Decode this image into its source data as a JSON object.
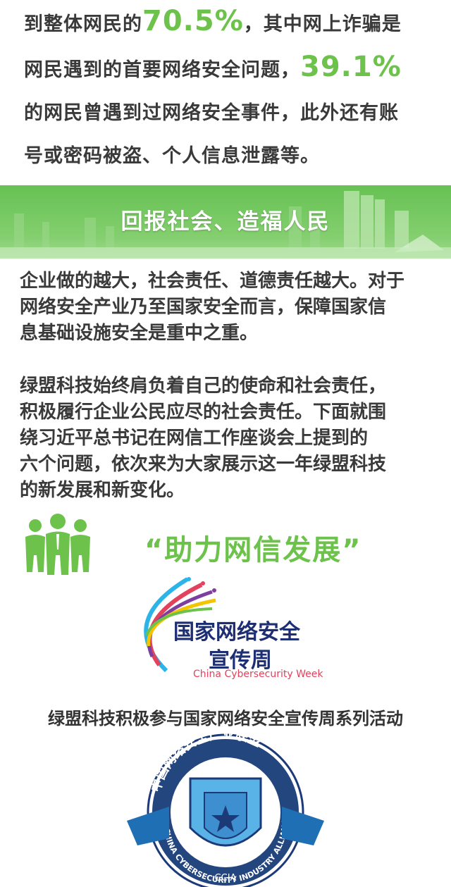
{
  "intro": {
    "line1_a": "到整体网民的",
    "line1_pct": "70.5%",
    "line1_b": "，其中网上诈骗是",
    "line2_a": "网民遇到的首要网络安全问题，",
    "line2_pct": "39.1%",
    "line3": "的网民曾遇到过网络安全事件，此外还有账",
    "line4": "号或密码被盗、个人信息泄露等。"
  },
  "banner": {
    "title": "回报社会、造福人民"
  },
  "para1": [
    "企业做的越大，社会责任、道德责任越大。对于",
    "网络安全产业乃至国家安全而言，保障国家信",
    "息基础设施安全是重中之重。"
  ],
  "para2": [
    "绿盟科技始终肩负着自己的使命和社会责任，",
    "积极履行企业公民应尽的社会责任。下面就围",
    "绕习近平总书记在网信工作座谈会上提到的",
    "六个问题，依次来为大家展示这一年绿盟科技",
    "的新发展和新变化。"
  ],
  "section": {
    "slogan": "“助力网信发展”",
    "icon": "people-group-icon"
  },
  "cyberweek_logo": {
    "title_line1": "国家网络安全",
    "title_line2": "宣传周",
    "english": "China Cybersecurity Week"
  },
  "caption": "绿盟科技积极参与国家网络安全宣传周系列活动",
  "ccia_logo": {
    "ring_text": "中国网络安全产业联盟",
    "english_ring": "CHINA CYBERSECURITY INDUSTRY ALLIANCE",
    "abbr": "CCIA"
  },
  "colors": {
    "accent_green": "#6cc24a",
    "navy": "#1d2e73",
    "pink": "#e2425b"
  }
}
